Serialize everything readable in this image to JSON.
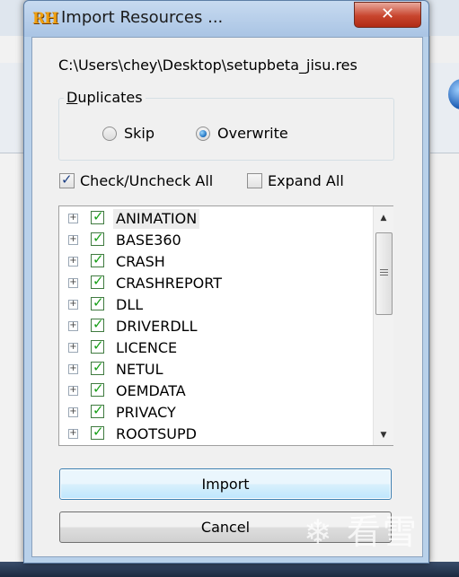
{
  "window": {
    "title": "Import Resources ...",
    "app_icon_text": "RH",
    "close_glyph": "✕"
  },
  "path_text": "C:\\Users\\chey\\Desktop\\setupbeta_jisu.res",
  "duplicates": {
    "label_prefix": "D",
    "label_rest": "uplicates",
    "options": [
      {
        "label": "Skip",
        "selected": false
      },
      {
        "label": "Overwrite",
        "selected": true
      }
    ]
  },
  "toggles": {
    "check_all": {
      "label": "Check/Uncheck All",
      "checked": true
    },
    "expand_all": {
      "label": "Expand All",
      "checked": false
    }
  },
  "tree": {
    "expander_glyph": "+",
    "items": [
      {
        "label": "ANIMATION",
        "checked": true,
        "selected": true
      },
      {
        "label": "BASE360",
        "checked": true
      },
      {
        "label": "CRASH",
        "checked": true
      },
      {
        "label": "CRASHREPORT",
        "checked": true
      },
      {
        "label": "DLL",
        "checked": true
      },
      {
        "label": "DRIVERDLL",
        "checked": true
      },
      {
        "label": "LICENCE",
        "checked": true
      },
      {
        "label": "NETUL",
        "checked": true
      },
      {
        "label": "OEMDATA",
        "checked": true
      },
      {
        "label": "PRIVACY",
        "checked": true
      },
      {
        "label": "ROOTSUPD",
        "checked": true
      }
    ],
    "scroll_up": "▲",
    "scroll_down": "▼"
  },
  "buttons": {
    "import": "Import",
    "cancel": "Cancel"
  },
  "watermark": "❄ 看雪",
  "colors": {
    "title_accent": "#f0a010",
    "close_red": "#c8452e",
    "check_green": "#18a018"
  }
}
